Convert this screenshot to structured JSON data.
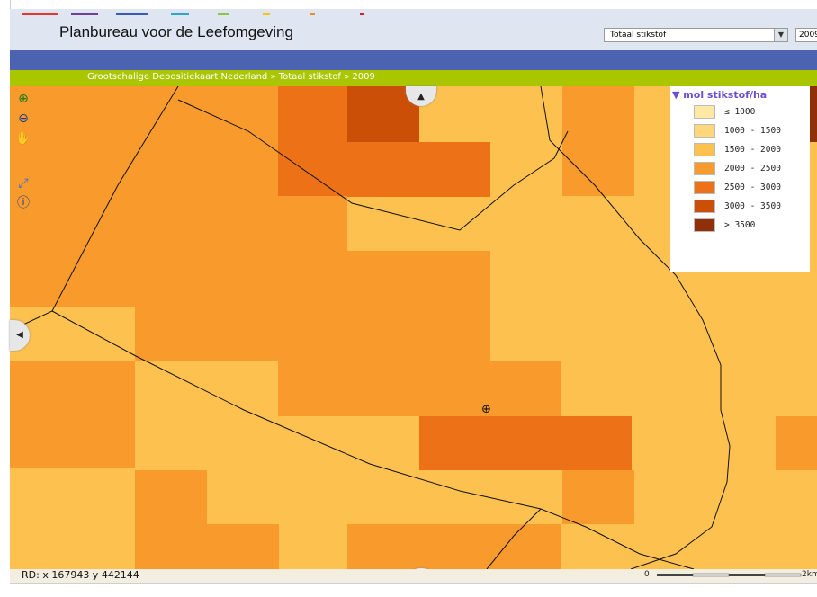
{
  "header": {
    "title": "Planbureau voor de Leefomgeving",
    "theme_select_value": "Totaal stikstof",
    "year_select_value": "2009",
    "brand_colors": [
      "#e8362d",
      "#6f3fa0",
      "#3a5bb0",
      "#2fa6c9",
      "#8ec63f",
      "#f3c31a",
      "#f08a1f",
      "#d2232a"
    ]
  },
  "breadcrumb": "Grootschalige Depositiekaart Nederland » Totaal stikstof » 2009",
  "tools": [
    {
      "name": "zoom-in-tool",
      "icon": "zoom-in-icon",
      "glyph": "⊕"
    },
    {
      "name": "zoom-out-tool",
      "icon": "zoom-out-icon",
      "glyph": "⊖"
    },
    {
      "name": "pan-hand-tool",
      "icon": "hand-icon",
      "glyph": "✋"
    },
    {
      "name": "full-extent-tool",
      "icon": "full-extent-icon",
      "glyph": "⤢"
    },
    {
      "name": "info-tool",
      "icon": "info-icon",
      "glyph": "ⓘ"
    }
  ],
  "pan_icons": {
    "up": "▲",
    "down": "▼",
    "left": "◀"
  },
  "legend": {
    "title": "mol stikstof/ha",
    "classes": [
      {
        "label": "≤ 1000",
        "color": "#fde9a3"
      },
      {
        "label": "1000 - 1500",
        "color": "#fdd77a"
      },
      {
        "label": "1500 - 2000",
        "color": "#fdc14f"
      },
      {
        "label": "2000 - 2500",
        "color": "#f99a2c"
      },
      {
        "label": "2500 - 3000",
        "color": "#ec7117"
      },
      {
        "label": "3000 - 3500",
        "color": "#cc4f08"
      },
      {
        "label": "> 3500",
        "color": "#8f3008"
      }
    ]
  },
  "status": {
    "coords_text": "RD: x 167943  y 442144",
    "scale_end_label": "2km",
    "scale_start_label": "0"
  }
}
